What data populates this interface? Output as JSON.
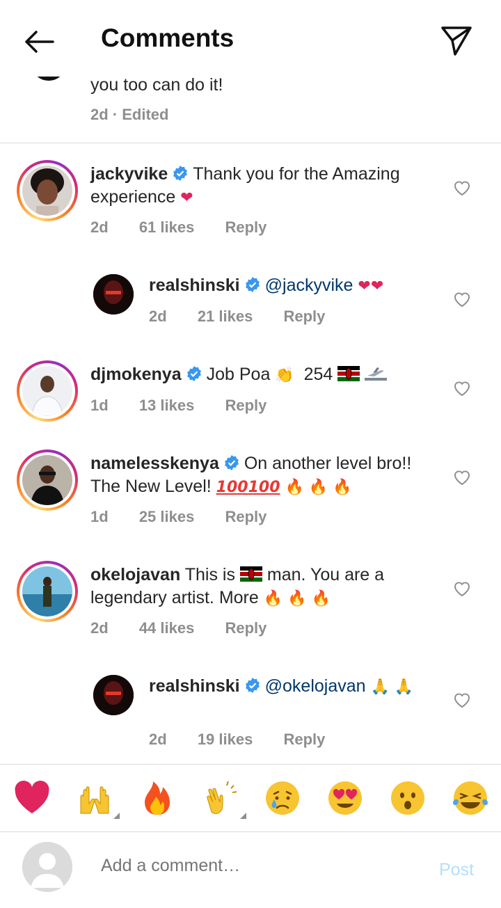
{
  "header": {
    "title": "Comments"
  },
  "previous_comment": {
    "text": "you too can do it!",
    "meta": "2d · Edited"
  },
  "comments": [
    {
      "user": "jackyvike",
      "verified": true,
      "text": "Thank you for the Amazing experience",
      "time": "2d",
      "likes": "61 likes",
      "reply": "Reply"
    },
    {
      "user": "realshinski",
      "verified": true,
      "mention": "@jackyvike",
      "time": "2d",
      "likes": "21 likes",
      "reply": "Reply"
    },
    {
      "user": "djmokenya",
      "verified": true,
      "text": "Job Poa",
      "text2": "254",
      "time": "1d",
      "likes": "13 likes",
      "reply": "Reply"
    },
    {
      "user": "namelesskenya",
      "verified": true,
      "text": "On another level bro!! The New Level!",
      "time": "1d",
      "likes": "25 likes",
      "reply": "Reply"
    },
    {
      "user": "okelojavan",
      "verified": false,
      "text": "This is",
      "text2": "man. You are a legendary artist. More",
      "time": "2d",
      "likes": "44 likes",
      "reply": "Reply"
    },
    {
      "user": "realshinski",
      "verified": true,
      "mention": "@okelojavan",
      "time": "2d",
      "likes": "19 likes",
      "reply": "Reply"
    }
  ],
  "reactions": [
    "heart",
    "raising-hands",
    "fire",
    "clapping-hands",
    "sad-tear",
    "heart-eyes",
    "surprised",
    "laughing-tears"
  ],
  "input": {
    "placeholder": "Add a comment…",
    "post_label": "Post"
  },
  "colors": {
    "verified": "#3897f0",
    "mention": "#00376b",
    "post": "#b2dffc",
    "muted": "#8e8e8e"
  }
}
